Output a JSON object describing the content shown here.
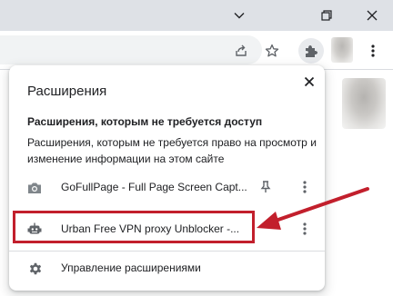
{
  "popup": {
    "title": "Расширения",
    "section_heading": "Расширения, которым не требуется доступ",
    "section_description": "Расширения, которым не требуется право на просмотр и изменение информации на этом сайте",
    "extensions": [
      {
        "name": "GoFullPage - Full Page Screen Capt...",
        "icon": "camera-icon",
        "highlighted": false
      },
      {
        "name": "Urban Free VPN proxy Unblocker -...",
        "icon": "robot-icon",
        "highlighted": true
      }
    ],
    "manage_label": "Управление расширениями"
  },
  "toolbar_icons": [
    "share-icon",
    "star-icon",
    "puzzle-icon",
    "avatar",
    "kebab-menu-icon"
  ],
  "window_controls": [
    "chevron-down-icon",
    "restore-icon",
    "close-icon"
  ],
  "colors": {
    "annotation_red": "#c21f2c",
    "titlebar": "#dee1e6",
    "icon_gray": "#5f6368"
  }
}
